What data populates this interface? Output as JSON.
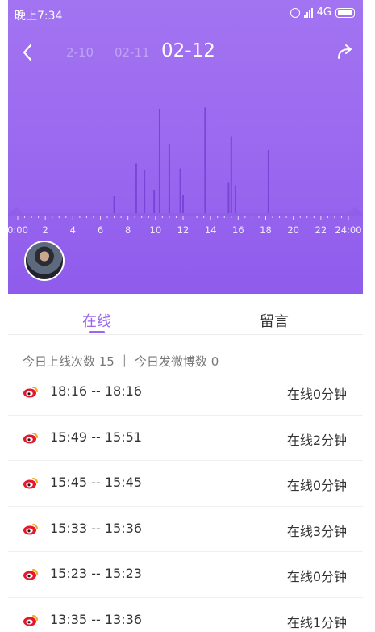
{
  "status_bar": {
    "time": "晚上7:34",
    "network": "4G",
    "icons": [
      "alarm-icon",
      "signal-icon",
      "battery-icon"
    ]
  },
  "header": {
    "back_icon": "chevron-left-icon",
    "share_icon": "share-arrow-icon",
    "dates": [
      "2-10",
      "02-11",
      "02-12"
    ],
    "selected_date": "02-12"
  },
  "chart_data": {
    "type": "bar",
    "xlabel": "",
    "ylabel": "",
    "x_ticks": [
      "0:00",
      "2",
      "4",
      "6",
      "8",
      "10",
      "12",
      "14",
      "16",
      "18",
      "20",
      "22",
      "24:00"
    ],
    "xlim": [
      0,
      24
    ],
    "ylim": [
      0,
      1
    ],
    "grid": false,
    "x": [
      7.0,
      8.6,
      9.2,
      9.9,
      10.3,
      11.0,
      11.8,
      12.0,
      13.6,
      15.3,
      15.5,
      15.8,
      18.2
    ],
    "values": [
      0.14,
      0.41,
      0.36,
      0.19,
      0.86,
      0.57,
      0.37,
      0.15,
      0.87,
      0.25,
      0.63,
      0.23,
      0.52
    ],
    "color": "#7a45d6"
  },
  "tabs": [
    {
      "label": "在线",
      "active": true
    },
    {
      "label": "留言",
      "active": false
    }
  ],
  "summary": {
    "online_count": "今日上线次数 15",
    "separator": "|",
    "post_count": "今日发微博数 0"
  },
  "sessions": [
    {
      "range": "18:16 -- 18:16",
      "duration": "在线0分钟"
    },
    {
      "range": "15:49 -- 15:51",
      "duration": "在线2分钟"
    },
    {
      "range": "15:45 -- 15:45",
      "duration": "在线0分钟"
    },
    {
      "range": "15:33 -- 15:36",
      "duration": "在线3分钟"
    },
    {
      "range": "15:23 -- 15:23",
      "duration": "在线0分钟"
    },
    {
      "range": "13:35 -- 13:36",
      "duration": "在线1分钟"
    }
  ],
  "colors": {
    "accent": "#9a68ef",
    "bar": "#7a45d6",
    "weibo_red": "#e6162d",
    "weibo_orange": "#f5a623"
  }
}
